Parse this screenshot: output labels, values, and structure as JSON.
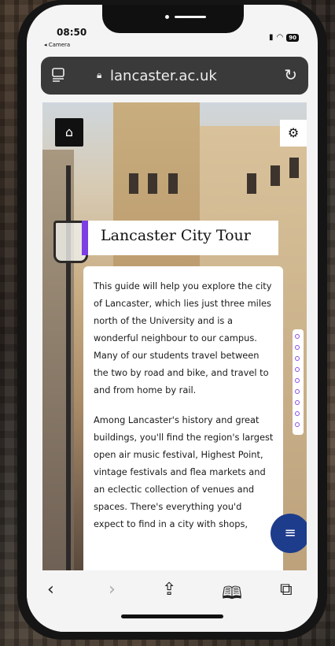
{
  "status": {
    "time": "08:50",
    "back_app": "◂ Camera",
    "battery": "90"
  },
  "browser": {
    "url": "lancaster.ac.uk"
  },
  "page": {
    "title": "Lancaster City Tour",
    "paragraphs": [
      "This guide will help you explore the city of Lancaster, which lies just three miles north of the University and is a wonderful neighbour to our campus. Many of our students travel between the two by road and bike, and travel to and from home by rail.",
      "Among Lancaster's history and great buildings, you'll find the region's largest open air music festival, Highest Point, vintage festivals and flea markets and an eclectic collection of venues and spaces. There's everything you'd expect to find in a city with shops,"
    ]
  },
  "icons": {
    "home": "home-icon",
    "settings": "gear-icon",
    "menu": "menu-icon",
    "back": "chevron-left-icon",
    "forward": "chevron-right-icon",
    "share": "share-icon",
    "bookmarks": "book-icon",
    "tabs": "tabs-icon"
  },
  "colors": {
    "accent": "#7b3fe4",
    "fab": "#1e3c8c"
  }
}
